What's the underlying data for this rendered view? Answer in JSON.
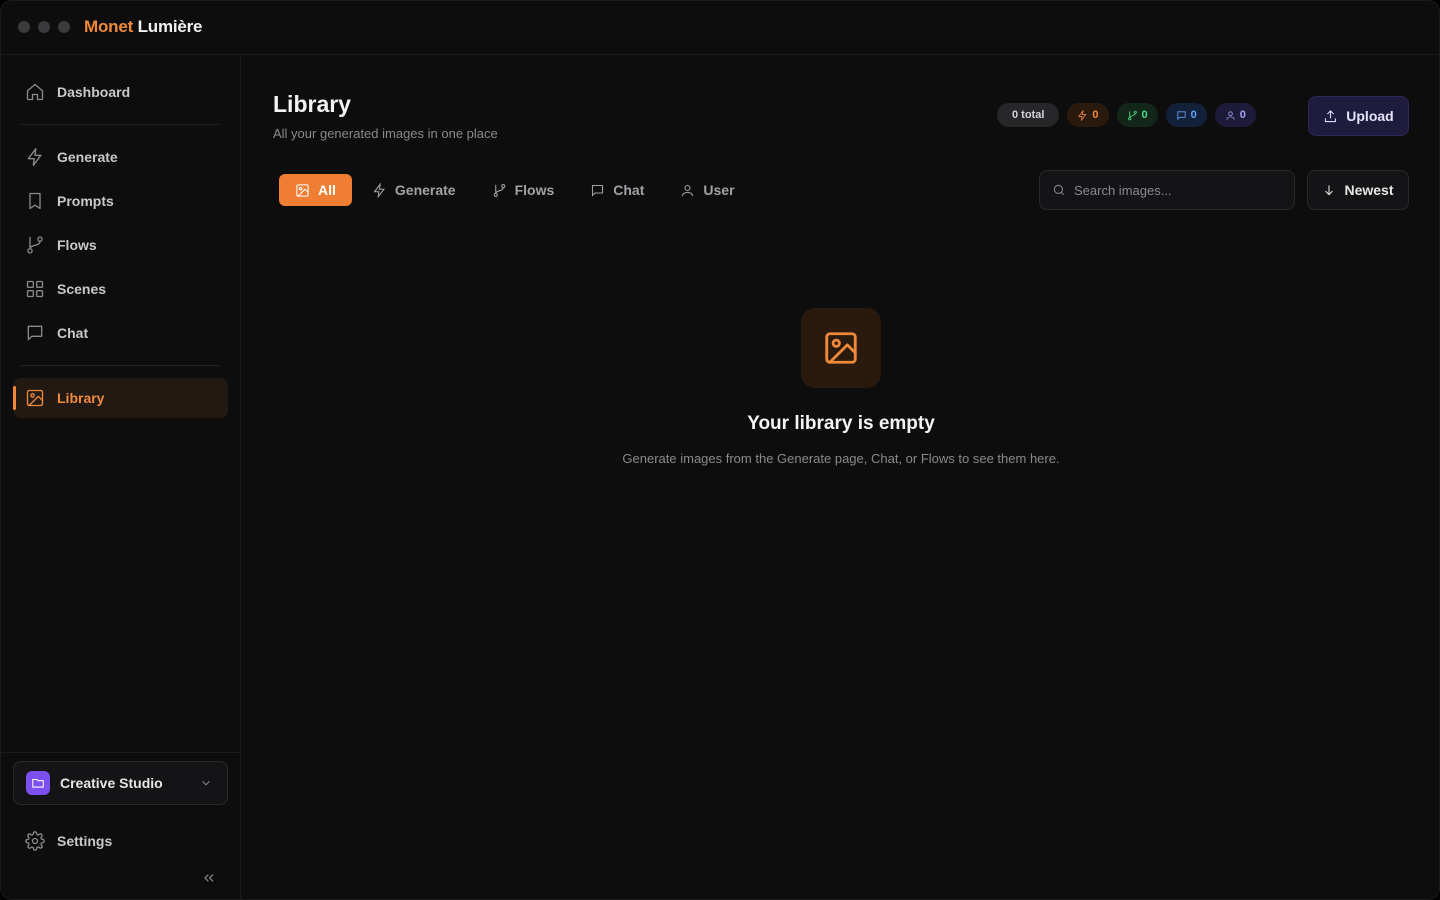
{
  "app": {
    "title_part1": "Monet",
    "title_part2": "Lumière",
    "accent_color": "#f08a3a"
  },
  "sidebar": {
    "items": [
      {
        "label": "Dashboard",
        "icon": "home-icon"
      },
      {
        "label": "Generate",
        "icon": "lightning-icon"
      },
      {
        "label": "Prompts",
        "icon": "bookmark-icon"
      },
      {
        "label": "Flows",
        "icon": "git-branch-icon"
      },
      {
        "label": "Scenes",
        "icon": "grid-icon"
      },
      {
        "label": "Chat",
        "icon": "message-icon"
      },
      {
        "label": "Library",
        "icon": "image-icon",
        "active": true
      }
    ],
    "workspace": {
      "label": "Creative Studio",
      "color": "#7b4ff0"
    },
    "settings_label": "Settings"
  },
  "header": {
    "title": "Library",
    "subtitle": "All your generated images in one place",
    "stats": {
      "total": "0 total",
      "generate": "0",
      "flows": "0",
      "chat": "0",
      "user": "0"
    },
    "upload_label": "Upload"
  },
  "filters": {
    "tabs": [
      {
        "label": "All",
        "icon": "image-icon",
        "active": true
      },
      {
        "label": "Generate",
        "icon": "lightning-icon"
      },
      {
        "label": "Flows",
        "icon": "git-branch-icon"
      },
      {
        "label": "Chat",
        "icon": "message-icon"
      },
      {
        "label": "User",
        "icon": "user-icon"
      }
    ],
    "search_placeholder": "Search images...",
    "sort_label": "Newest"
  },
  "empty_state": {
    "title": "Your library is empty",
    "description": "Generate images from the Generate page, Chat, or Flows to see them here."
  }
}
